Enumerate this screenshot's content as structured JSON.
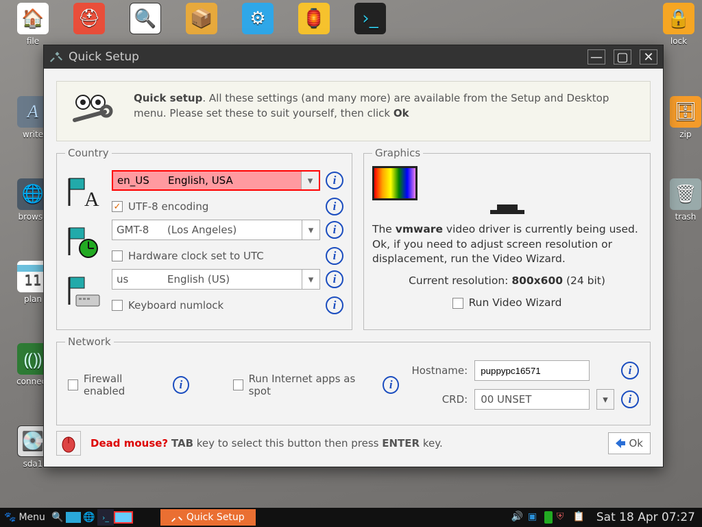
{
  "window": {
    "title": "Quick Setup"
  },
  "intro": {
    "lead": "Quick setup",
    "text": ". All these settings (and many more) are available from the Setup and Desktop menu. Please set these to suit yourself, then click ",
    "ok": "Ok"
  },
  "country": {
    "legend": "Country",
    "locale": {
      "code": "en_US",
      "name": "English, USA"
    },
    "utf8_label": "UTF-8 encoding",
    "utf8_checked": true,
    "tz": {
      "code": "GMT-8",
      "name": "(Los Angeles)"
    },
    "hwclock_label": "Hardware clock set to UTC",
    "hwclock_checked": false,
    "kb": {
      "code": "us",
      "name": "English (US)"
    },
    "numlock_label": "Keyboard numlock",
    "numlock_checked": false
  },
  "graphics": {
    "legend": "Graphics",
    "line1_a": "The ",
    "line1_b": "vmware",
    "line1_c": " video driver is currently being used. Ok, if you need to adjust screen resolution or displacement, run the Video Wizard.",
    "res_label": "Current resolution: ",
    "res_value": "800x600",
    "res_depth": "  (24 bit)",
    "runwiz_label": "Run Video Wizard",
    "runwiz_checked": false
  },
  "network": {
    "legend": "Network",
    "firewall_label": "Firewall enabled",
    "firewall_checked": false,
    "spot_label": "Run Internet apps as spot",
    "spot_checked": false,
    "hostname_label": "Hostname:",
    "hostname_value": "puppypc16571",
    "crd_label": "CRD:",
    "crd_value": "00 UNSET"
  },
  "footer": {
    "dead": "Dead mouse?",
    "tab": "TAB",
    "t1": " key to select this button then press ",
    "enter": "ENTER",
    "t2": " key.",
    "ok": "Ok"
  },
  "taskbar": {
    "menu": "Menu",
    "active": "Quick Setup",
    "clock": "Sat 18 Apr 07:27"
  },
  "desktop_icons": {
    "file": "file",
    "write": "write",
    "browse": "browse",
    "plan": "plan",
    "connect": "connect",
    "sda1": "sda1",
    "zip": "zip",
    "trash": "trash",
    "lock": "lock",
    "day": "11"
  }
}
